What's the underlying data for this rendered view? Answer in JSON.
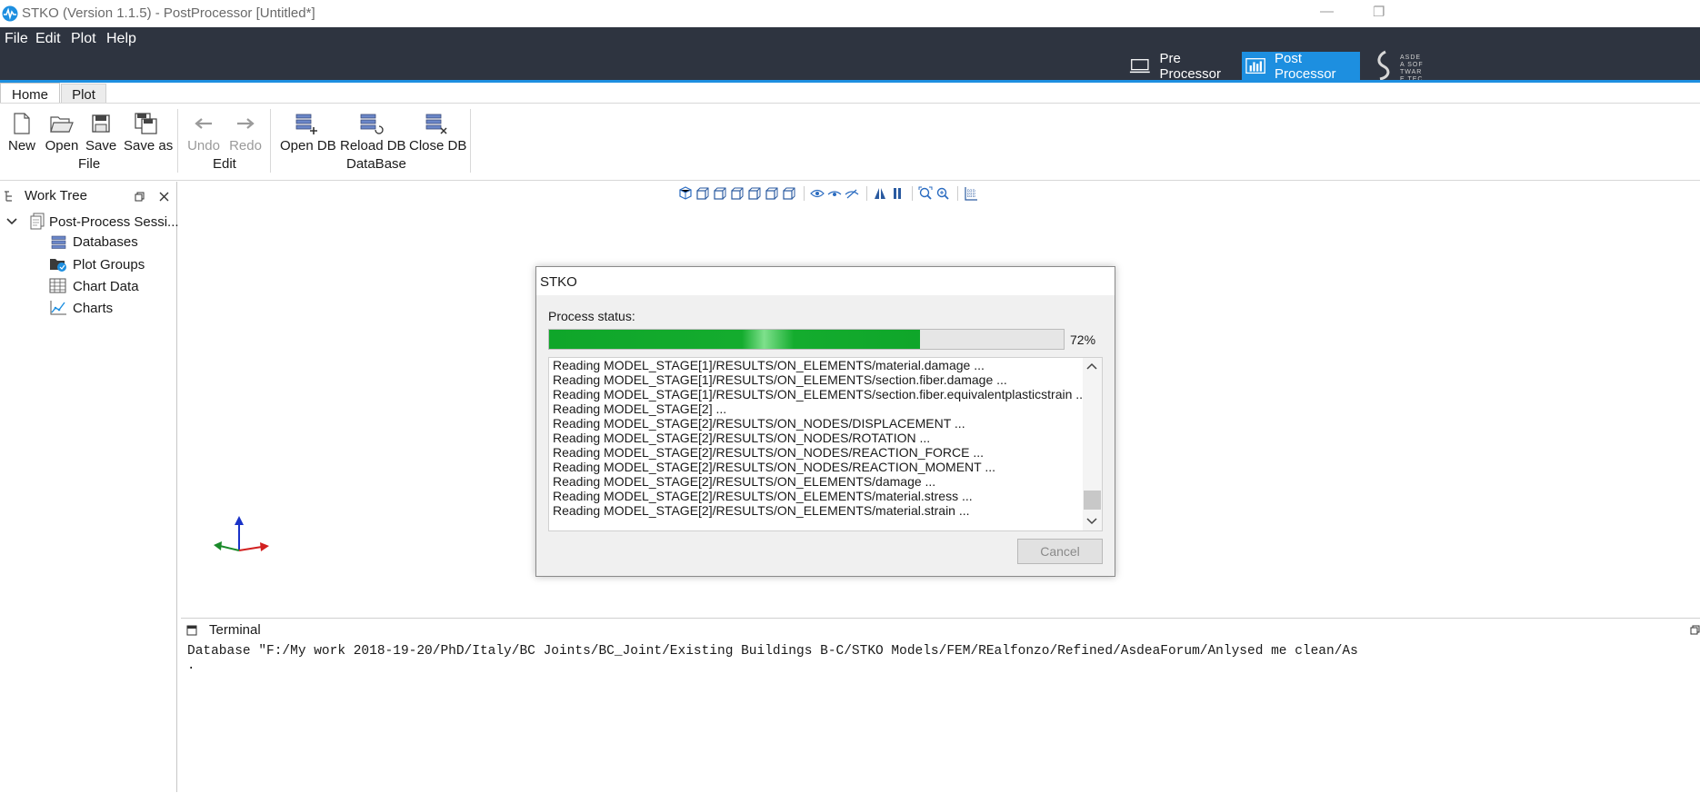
{
  "window": {
    "title": "STKO (Version 1.1.5) - PostProcessor [Untitled*]",
    "minimize_glyph": "—",
    "restore_glyph": "❐"
  },
  "menu": [
    "File",
    "Edit",
    "Plot",
    "Help"
  ],
  "modes": {
    "pre": "Pre Processor",
    "post": "Post Processor",
    "logo_text": "ASDEA SOFTWARE TECHNOLOGY"
  },
  "ribbon": {
    "tabs": [
      "Home",
      "Plot"
    ],
    "file": {
      "group": "File",
      "new": "New",
      "open": "Open",
      "save": "Save",
      "save_as": "Save as"
    },
    "edit": {
      "group": "Edit",
      "undo": "Undo",
      "redo": "Redo"
    },
    "database": {
      "group": "DataBase",
      "open_db": "Open DB",
      "reload_db": "Reload DB",
      "close_db": "Close DB"
    }
  },
  "work_tree": {
    "title": "Work Tree",
    "root": "Post-Process Sessi...",
    "children": [
      "Databases",
      "Plot Groups",
      "Chart Data",
      "Charts"
    ]
  },
  "dialog": {
    "title": "STKO",
    "status_label": "Process status:",
    "progress": 0.72,
    "progress_text": "72%",
    "log": [
      "Reading MODEL_STAGE[1]/RESULTS/ON_ELEMENTS/material.damage ...",
      "Reading MODEL_STAGE[1]/RESULTS/ON_ELEMENTS/section.fiber.damage ...",
      "Reading MODEL_STAGE[1]/RESULTS/ON_ELEMENTS/section.fiber.equivalentplasticstrain ...",
      "Reading MODEL_STAGE[2] ...",
      "Reading MODEL_STAGE[2]/RESULTS/ON_NODES/DISPLACEMENT ...",
      "Reading MODEL_STAGE[2]/RESULTS/ON_NODES/ROTATION ...",
      "Reading MODEL_STAGE[2]/RESULTS/ON_NODES/REACTION_FORCE ...",
      "Reading MODEL_STAGE[2]/RESULTS/ON_NODES/REACTION_MOMENT ...",
      "Reading MODEL_STAGE[2]/RESULTS/ON_ELEMENTS/damage ...",
      "Reading MODEL_STAGE[2]/RESULTS/ON_ELEMENTS/material.stress ...",
      "Reading MODEL_STAGE[2]/RESULTS/ON_ELEMENTS/material.strain ..."
    ],
    "cancel": "Cancel"
  },
  "terminal": {
    "title": "Terminal",
    "line1": "Database \"F:/My work 2018-19-20/PhD/Italy/BC Joints/BC_Joint/Existing Buildings B-C/STKO Models/FEM/REalfonzo/Refined/AsdeaForum/Anlysed me clean/As"
  },
  "colors": {
    "accent": "#1d8fe0",
    "dark_bar": "#2e3440",
    "progress_fill": "#1aa832",
    "axis_x": "#d22020",
    "axis_y": "#1a33c8",
    "axis_z": "#1a8a2a"
  }
}
